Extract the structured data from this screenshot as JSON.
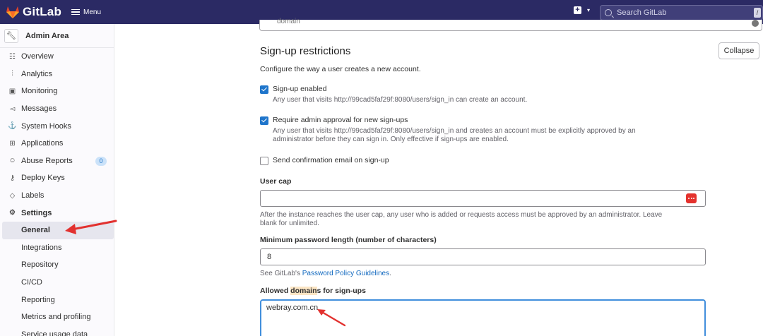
{
  "topbar": {
    "logo_text": "GitLab",
    "menu_label": "Menu",
    "search_placeholder": "Search GitLab",
    "search_shortcut": "/",
    "brand_color": "#2b2a64"
  },
  "sidebar": {
    "header": "Admin Area",
    "items": [
      {
        "label": "Overview",
        "icon": "overview-icon",
        "glyph": "☷"
      },
      {
        "label": "Analytics",
        "icon": "analytics-icon",
        "glyph": "⫶"
      },
      {
        "label": "Monitoring",
        "icon": "monitoring-icon",
        "glyph": "▣"
      },
      {
        "label": "Messages",
        "icon": "messages-icon",
        "glyph": "◅"
      },
      {
        "label": "System Hooks",
        "icon": "hooks-icon",
        "glyph": "⚓"
      },
      {
        "label": "Applications",
        "icon": "applications-icon",
        "glyph": "⊞"
      },
      {
        "label": "Abuse Reports",
        "icon": "abuse-icon",
        "glyph": "☺",
        "badge": "0"
      },
      {
        "label": "Deploy Keys",
        "icon": "key-icon",
        "glyph": "⚷"
      },
      {
        "label": "Labels",
        "icon": "label-icon",
        "glyph": "◇"
      },
      {
        "label": "Settings",
        "icon": "settings-icon",
        "glyph": "⚙"
      }
    ],
    "settings_sub": [
      "General",
      "Integrations",
      "Repository",
      "CI/CD",
      "Reporting",
      "Metrics and profiling",
      "Service usage data"
    ],
    "active_sub": "General"
  },
  "filter": {
    "value": "domain"
  },
  "section": {
    "title": "Sign-up restrictions",
    "collapse_label": "Collapse",
    "description": "Configure the way a user creates a new account."
  },
  "options": {
    "signup_enabled": {
      "checked": true,
      "label": "Sign-up enabled",
      "help": "Any user that visits http://99cad5faf29f:8080/users/sign_in can create an account."
    },
    "admin_approval": {
      "checked": true,
      "label": "Require admin approval for new sign-ups",
      "help_line1": "Any user that visits http://99cad5faf29f:8080/users/sign_in and creates an account must be explicitly approved by an",
      "help_line2": "administrator before they can sign in. Only effective if sign-ups are enabled."
    },
    "confirm_email": {
      "checked": false,
      "label": "Send confirmation email on sign-up"
    }
  },
  "user_cap": {
    "label": "User cap",
    "value": "",
    "help_line1": "After the instance reaches the user cap, any user who is added or requests access must be approved by an administrator. Leave",
    "help_line2": "blank for unlimited."
  },
  "min_password": {
    "label": "Minimum password length (number of characters)",
    "value": "8",
    "help_prefix": "See GitLab's ",
    "help_link": "Password Policy Guidelines",
    "help_suffix": "."
  },
  "allowed_domains": {
    "label_prefix": "Allowed ",
    "label_highlight": "domain",
    "label_suffix": "s for sign-ups",
    "value": "webray.com.cn"
  },
  "colors": {
    "accent": "#1f75cb",
    "arrow": "#e2312f",
    "highlight": "#fbe5c4"
  }
}
